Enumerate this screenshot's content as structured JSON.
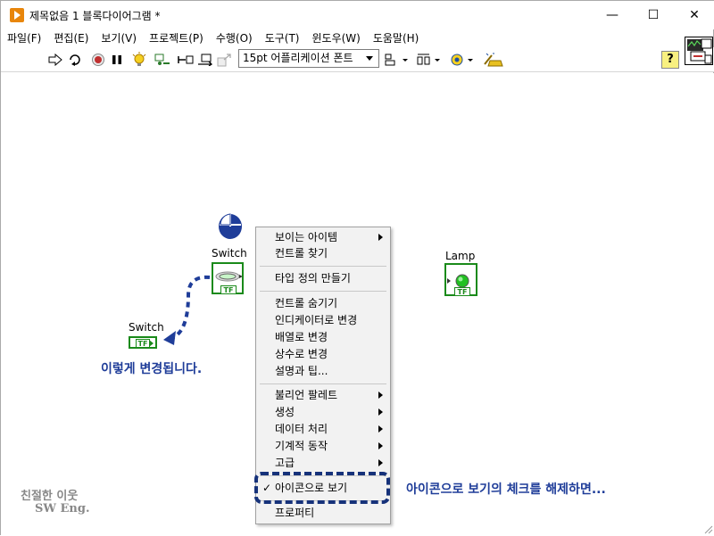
{
  "title_bar": {
    "title": "제목없음 1 블록다이어그램 *",
    "minimize": "—",
    "maximize": "☐",
    "close": "✕"
  },
  "menu": [
    "파일(F)",
    "편집(E)",
    "보기(V)",
    "프로젝트(P)",
    "수행(O)",
    "도구(T)",
    "윈도우(W)",
    "도움말(H)"
  ],
  "toolbar": {
    "font_select_value": "15pt 어플리케이션 폰트",
    "help_label": "?"
  },
  "canvas": {
    "switch_label": "Switch",
    "switch_indicator_label": "Switch",
    "switch_tf": "TF",
    "switch_indicator_tf": "TF",
    "lamp_label": "Lamp",
    "lamp_tf": "TF"
  },
  "context_menu": {
    "items": [
      {
        "label": "보이는 아이템",
        "submenu": true
      },
      {
        "label": "컨트롤 찾기",
        "submenu": false
      },
      {
        "label": "타입 정의 만들기",
        "submenu": false
      },
      {
        "label": "컨트롤 숨기기",
        "submenu": false
      },
      {
        "label": "인디케이터로 변경",
        "submenu": false
      },
      {
        "label": "배열로 변경",
        "submenu": false
      },
      {
        "label": "상수로 변경",
        "submenu": false
      },
      {
        "label": "설명과 팁...",
        "submenu": false
      },
      {
        "label": "불리언 팔레트",
        "submenu": true
      },
      {
        "label": "생성",
        "submenu": true
      },
      {
        "label": "데이터 처리",
        "submenu": true
      },
      {
        "label": "기계적 동작",
        "submenu": true
      },
      {
        "label": "고급",
        "submenu": true
      },
      {
        "label": "아이콘으로 보기",
        "submenu": false,
        "checked": true
      },
      {
        "label": "프로퍼티",
        "submenu": false
      }
    ],
    "check_mark": "✓"
  },
  "annotations": {
    "changed_text": "이렇게 변경됩니다.",
    "uncheck_text": "아이콘으로 보기의 체크를 해제하면..."
  },
  "watermark": {
    "line1": "친절한 이웃",
    "line2": "SW Eng."
  },
  "colors": {
    "accent_blue": "#1f3d99",
    "terminal_green": "#1a8a1a",
    "lamp_green": "#22c022"
  }
}
